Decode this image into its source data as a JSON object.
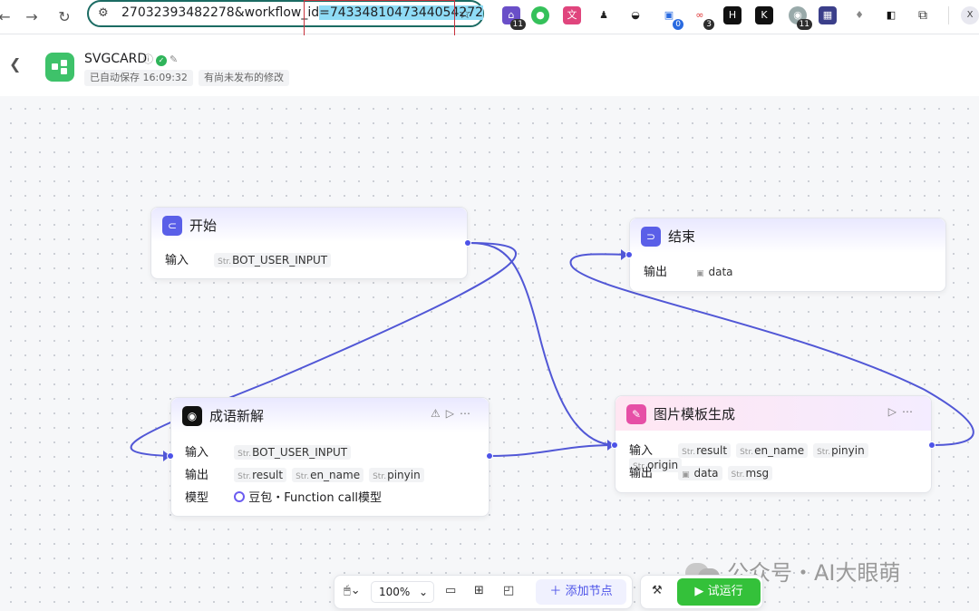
{
  "browser": {
    "url_prefix": "27032393482278&workflow_id",
    "url_highlight": "=7433481047344054272",
    "extension_badges": [
      "11",
      "0",
      "3",
      "11"
    ],
    "profile_initial": "X"
  },
  "header": {
    "title": "SVGCARD",
    "autosave": "已自动保存 16:09:32",
    "unpublished": "有尚未发布的修改"
  },
  "nodes": {
    "start": {
      "title": "开始",
      "input_label": "输入",
      "input_tags": [
        {
          "type": "Str.",
          "name": "BOT_USER_INPUT"
        }
      ]
    },
    "end": {
      "title": "结束",
      "output_label": "输出",
      "output_tags": [
        {
          "type": "img",
          "name": "data"
        }
      ]
    },
    "idiom": {
      "title": "成语新解",
      "input_label": "输入",
      "input_tags": [
        {
          "type": "Str.",
          "name": "BOT_USER_INPUT"
        }
      ],
      "output_label": "输出",
      "output_tags": [
        {
          "type": "Str.",
          "name": "result"
        },
        {
          "type": "Str.",
          "name": "en_name"
        },
        {
          "type": "Str.",
          "name": "pinyin"
        }
      ],
      "model_label": "模型",
      "model_value": "豆包・Function call模型"
    },
    "image": {
      "title": "图片模板生成",
      "input_label": "输入",
      "input_tags": [
        {
          "type": "Str.",
          "name": "result"
        },
        {
          "type": "Str.",
          "name": "en_name"
        },
        {
          "type": "Str.",
          "name": "pinyin"
        },
        {
          "type": "Str.",
          "name": "origin"
        }
      ],
      "output_label": "输出",
      "output_tags": [
        {
          "type": "img",
          "name": "data"
        },
        {
          "type": "Str.",
          "name": "msg"
        }
      ]
    }
  },
  "toolbar": {
    "zoom": "100%",
    "add_node": "添加节点",
    "run": "试运行"
  },
  "watermark": "公众号・AI大眼萌",
  "colors": {
    "accent": "#4d53e8",
    "run_green": "#34c13a",
    "logo_green": "#3ec26a"
  }
}
